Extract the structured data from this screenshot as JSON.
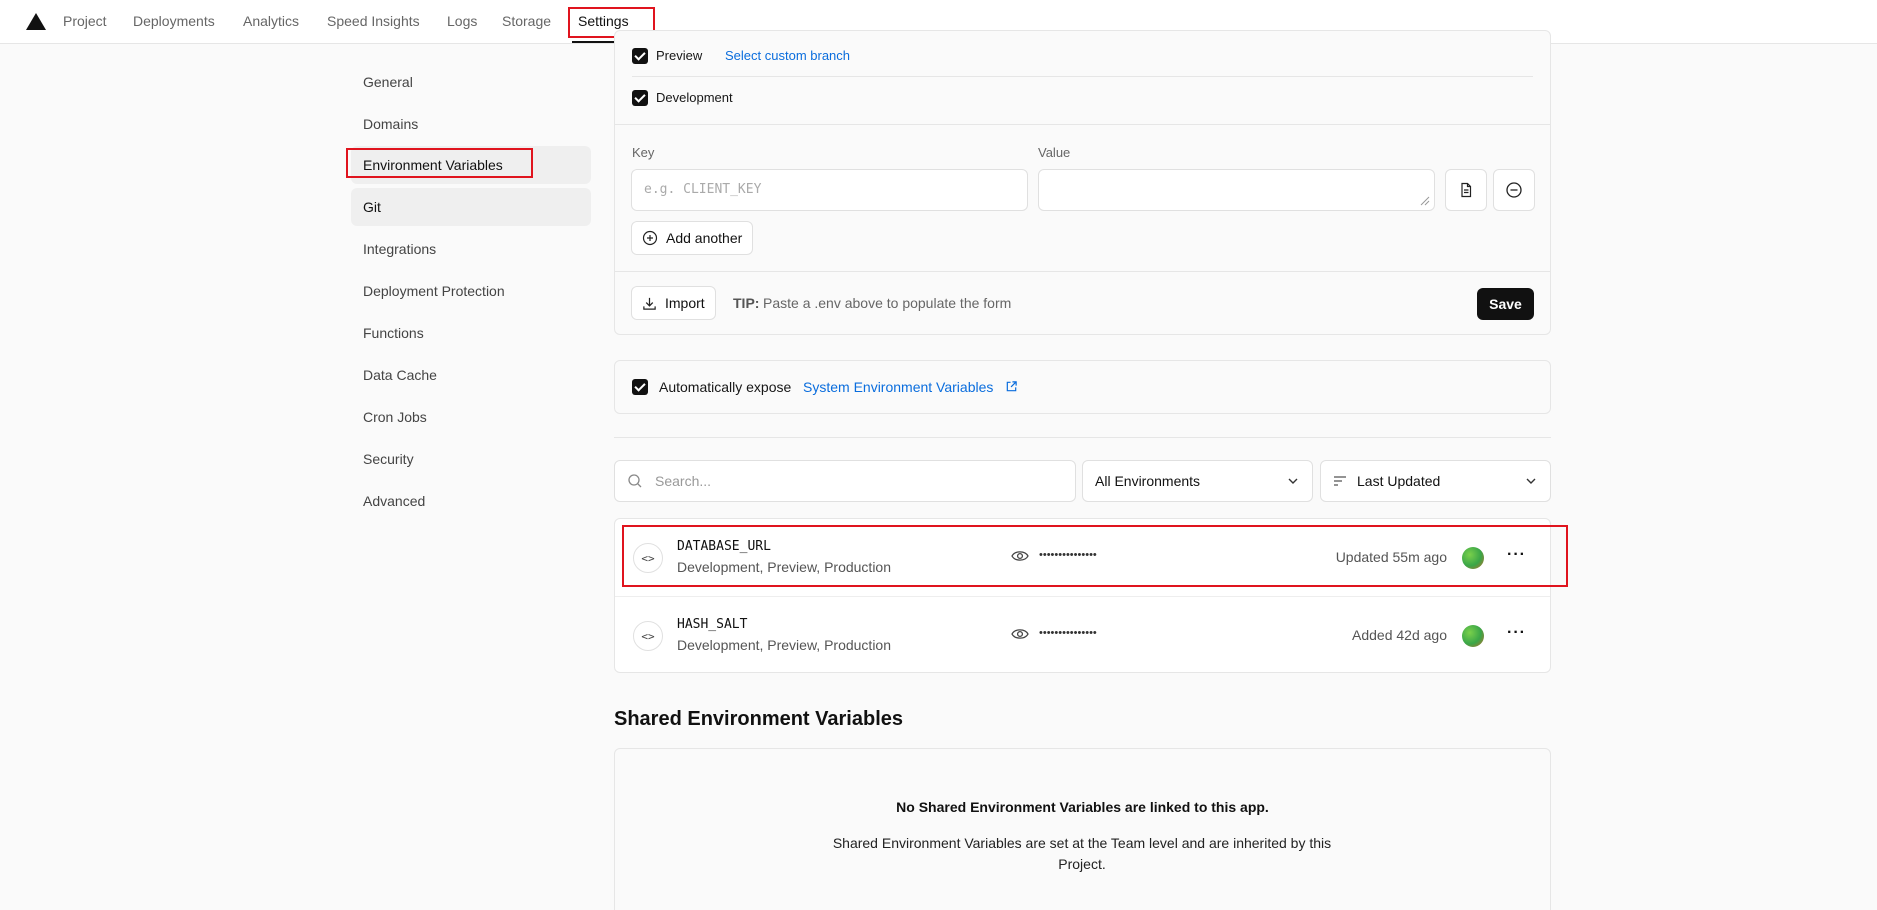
{
  "nav": {
    "tabs": [
      {
        "label": "Project"
      },
      {
        "label": "Deployments"
      },
      {
        "label": "Analytics"
      },
      {
        "label": "Speed Insights"
      },
      {
        "label": "Logs"
      },
      {
        "label": "Storage"
      },
      {
        "label": "Settings",
        "active": true
      }
    ]
  },
  "sidebar": {
    "items": [
      {
        "label": "General"
      },
      {
        "label": "Domains"
      },
      {
        "label": "Environment Variables",
        "active": true
      },
      {
        "label": "Git"
      },
      {
        "label": "Integrations"
      },
      {
        "label": "Deployment Protection"
      },
      {
        "label": "Functions"
      },
      {
        "label": "Data Cache"
      },
      {
        "label": "Cron Jobs"
      },
      {
        "label": "Security"
      },
      {
        "label": "Advanced"
      }
    ]
  },
  "form": {
    "env_preview": "Preview",
    "custom_branch_link": "Select custom branch",
    "env_development": "Development",
    "key_label": "Key",
    "key_placeholder": "e.g. CLIENT_KEY",
    "value_label": "Value",
    "add_another": "Add another",
    "import": "Import",
    "tip_label": "TIP:",
    "tip_text": "Paste a .env above to populate the form",
    "save": "Save"
  },
  "system_vars": {
    "prefix": "Automatically expose",
    "link": "System Environment Variables"
  },
  "filters": {
    "search_placeholder": "Search...",
    "environment": "All Environments",
    "sort": "Last Updated"
  },
  "env_vars": [
    {
      "key": "DATABASE_URL",
      "targets": "Development, Preview, Production",
      "masked": "•••••••••••••••",
      "time": "Updated 55m ago"
    },
    {
      "key": "HASH_SALT",
      "targets": "Development, Preview, Production",
      "masked": "•••••••••••••••",
      "time": "Added 42d ago"
    }
  ],
  "shared": {
    "title": "Shared Environment Variables",
    "empty_title": "No Shared Environment Variables are linked to this app.",
    "empty_desc": "Shared Environment Variables are set at the Team level and are inherited by this Project."
  },
  "colors": {
    "accent_link": "#0a6ddd",
    "highlight": "#e0141e",
    "primary_button": "#111111"
  }
}
